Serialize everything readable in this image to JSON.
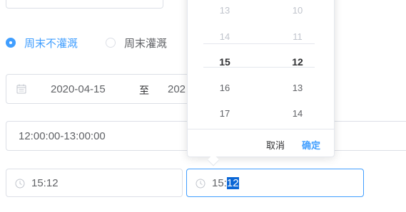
{
  "top_input": {
    "value": ""
  },
  "radio_group": {
    "options": [
      {
        "label": "周末不灌溉",
        "checked": true
      },
      {
        "label": "周末灌溉",
        "checked": false
      }
    ]
  },
  "date_range": {
    "start": "2020-04-15",
    "separator": "至",
    "end": "202"
  },
  "time_range": {
    "value": "12:00:00-13:00:00"
  },
  "time_picker_1": {
    "value": "15:12"
  },
  "time_picker_2": {
    "value_prefix": "15:",
    "value_selected": "12"
  },
  "time_panel": {
    "hours": [
      "13",
      "14",
      "15",
      "16",
      "17"
    ],
    "minutes": [
      "10",
      "11",
      "12",
      "13",
      "14"
    ],
    "selected_hour": "15",
    "selected_minute": "12",
    "cancel_label": "取消",
    "confirm_label": "确定"
  },
  "colors": {
    "accent": "#409eff",
    "border": "#dcdfe6",
    "text": "#606266",
    "selection": "#0a66d6"
  }
}
